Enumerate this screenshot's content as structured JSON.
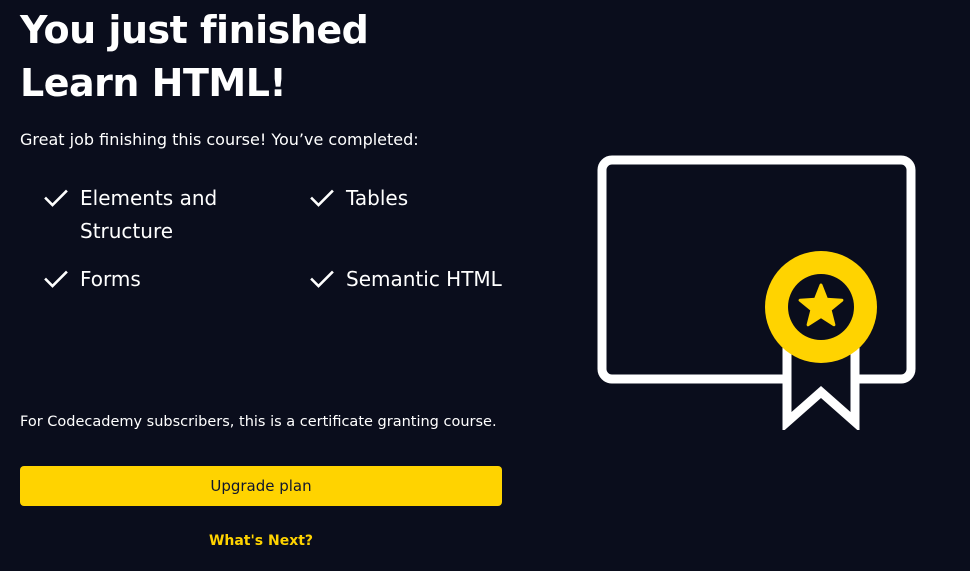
{
  "hero": {
    "title_line_1": "You just finished",
    "title_line_2": "Learn HTML!"
  },
  "intro_text": "Great job finishing this course! You’ve completed:",
  "completed_items": [
    {
      "label_line_1": "Elements and",
      "label_line_2": "Structure"
    },
    {
      "label_line_1": "Tables",
      "label_line_2": ""
    },
    {
      "label_line_1": "Forms",
      "label_line_2": ""
    },
    {
      "label_line_1": "Semantic HTML",
      "label_line_2": ""
    }
  ],
  "subscriber_note": "For Codecademy subscribers, this is a certificate granting course.",
  "upgrade_button_label": "Upgrade plan",
  "whats_next_label": "What's Next?",
  "icons": {
    "check": "check-icon",
    "certificate": "certificate-icon",
    "star": "star-icon"
  },
  "colors": {
    "background": "#0a0d1c",
    "accent": "#ffd300",
    "text": "#ffffff",
    "button_text": "#10162f"
  }
}
